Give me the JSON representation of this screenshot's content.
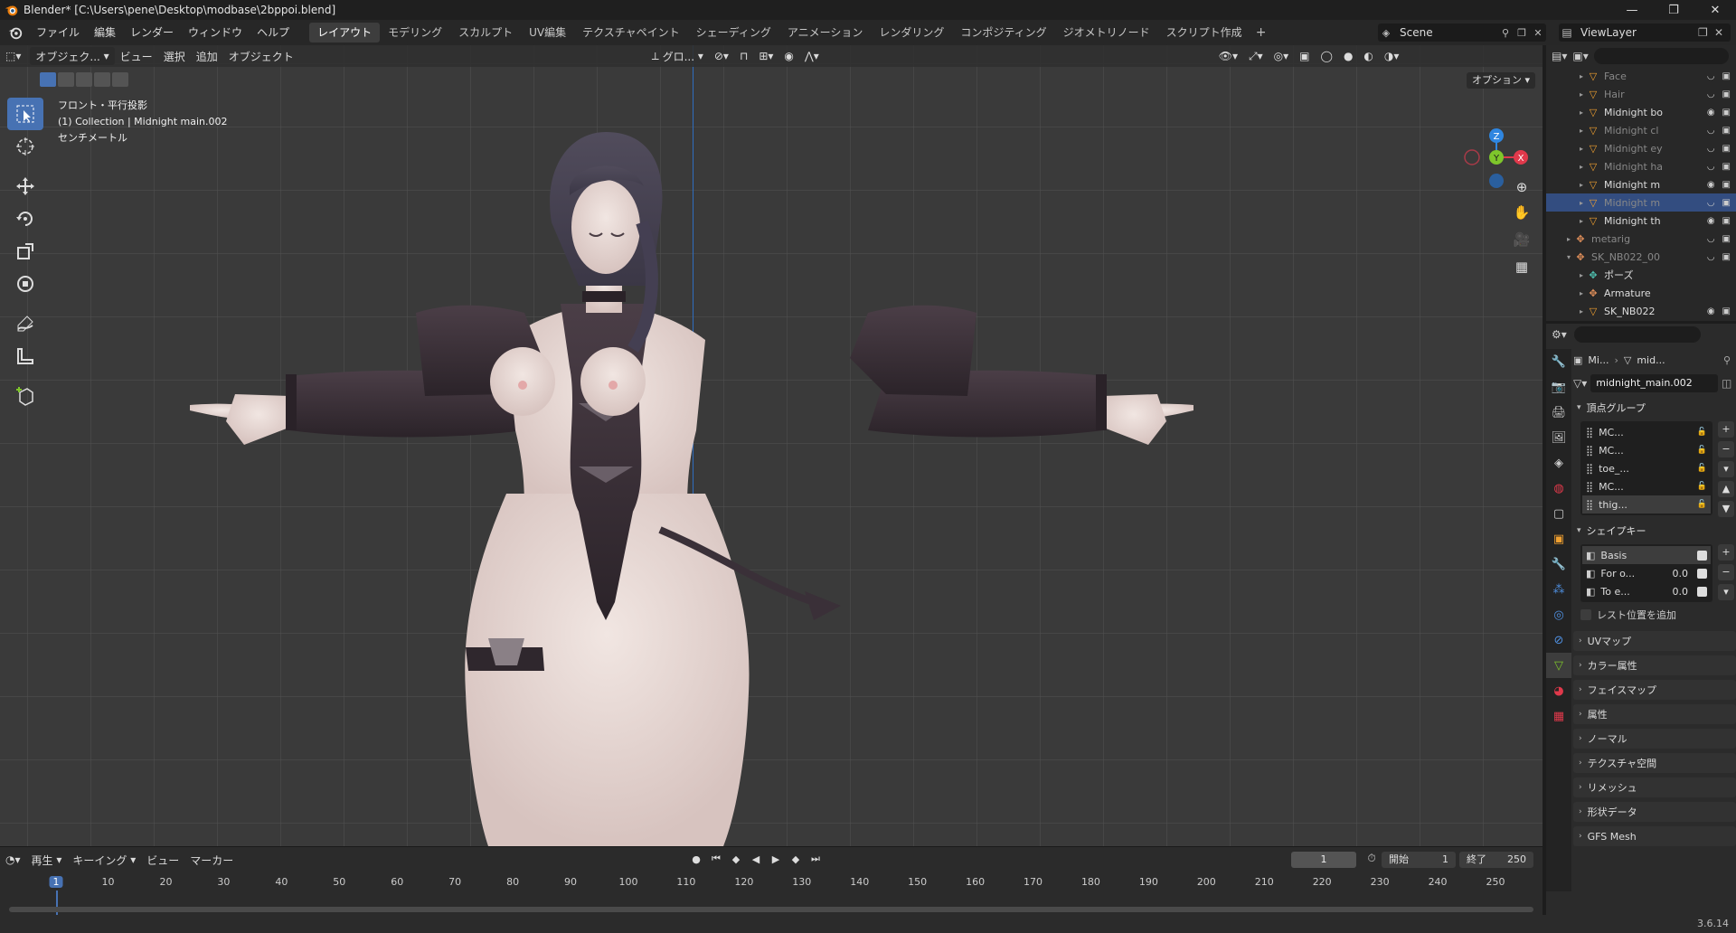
{
  "window": {
    "title": "Blender* [C:\\Users\\pene\\Desktop\\modbase\\2bppoi.blend]",
    "controls": [
      "—",
      "❐",
      "✕"
    ]
  },
  "menu": [
    "ファイル",
    "編集",
    "レンダー",
    "ウィンドウ",
    "ヘルプ"
  ],
  "workspaces": [
    "レイアウト",
    "モデリング",
    "スカルプト",
    "UV編集",
    "テクスチャペイント",
    "シェーディング",
    "アニメーション",
    "レンダリング",
    "コンポジティング",
    "ジオメトリノード",
    "スクリプト作成"
  ],
  "workspace_active": 0,
  "scene": "Scene",
  "view_layer": "ViewLayer",
  "viewport": {
    "mode": "オブジェク...",
    "menus": [
      "ビュー",
      "選択",
      "追加",
      "オブジェクト"
    ],
    "transform": "グロ...",
    "options": "オプション",
    "info_line1": "フロント・平行投影",
    "info_line2": "(1) Collection | Midnight main.002",
    "info_line3": "センチメートル",
    "gizmo": {
      "z": "Z",
      "y": "Y",
      "x": "X"
    }
  },
  "timeline": {
    "menus": [
      "再生",
      "キーイング",
      "ビュー",
      "マーカー"
    ],
    "current_frame": "1",
    "start_label": "開始",
    "start": "1",
    "end_label": "終了",
    "end": "250",
    "ruler": [
      "1",
      "10",
      "20",
      "30",
      "40",
      "50",
      "60",
      "70",
      "80",
      "90",
      "100",
      "110",
      "120",
      "130",
      "140",
      "150",
      "160",
      "170",
      "180",
      "190",
      "200",
      "210",
      "220",
      "230",
      "240",
      "250"
    ]
  },
  "outliner": {
    "rows": [
      {
        "name": "Face",
        "type": "mesh",
        "dim": true
      },
      {
        "name": "Hair",
        "type": "mesh",
        "dim": true
      },
      {
        "name": "Midnight bo",
        "type": "mesh",
        "dim": false
      },
      {
        "name": "Midnight cl",
        "type": "mesh",
        "dim": true
      },
      {
        "name": "Midnight ey",
        "type": "mesh",
        "dim": true
      },
      {
        "name": "Midnight ha",
        "type": "mesh",
        "dim": true
      },
      {
        "name": "Midnight m",
        "type": "mesh",
        "dim": false
      },
      {
        "name": "Midnight m",
        "type": "mesh",
        "dim": true,
        "selected": true
      },
      {
        "name": "Midnight th",
        "type": "mesh",
        "dim": false
      },
      {
        "name": "metarig",
        "type": "armature",
        "dim": true
      },
      {
        "name": "SK_NB022_00",
        "type": "armature",
        "dim": true
      },
      {
        "name": "ポーズ",
        "type": "pose",
        "dim": false
      },
      {
        "name": "Armature",
        "type": "armature",
        "dim": false
      },
      {
        "name": "SK_NB022",
        "type": "mesh",
        "dim": false
      }
    ]
  },
  "properties": {
    "crumb_object": "Mi...",
    "crumb_data": "mid...",
    "mesh_name": "midnight_main.002",
    "vertex_groups_title": "頂点グループ",
    "vertex_groups": [
      "MC...",
      "MC...",
      "toe_...",
      "MC...",
      "thig..."
    ],
    "shape_keys_title": "シェイプキー",
    "shape_keys": [
      {
        "name": "Basis",
        "value": ""
      },
      {
        "name": "For o...",
        "value": "0.0"
      },
      {
        "name": "To e...",
        "value": "0.0"
      }
    ],
    "rest_position": "レスト位置を追加",
    "panels": [
      "UVマップ",
      "カラー属性",
      "フェイスマップ",
      "属性",
      "ノーマル",
      "テクスチャ空間",
      "リメッシュ",
      "形状データ",
      "GFS Mesh"
    ]
  },
  "status": {
    "version": "3.6.14"
  },
  "colors": {
    "accent": "#4772b3",
    "x_axis": "#e0394b",
    "y_axis": "#7ec62b",
    "z_axis": "#2f86e0"
  }
}
